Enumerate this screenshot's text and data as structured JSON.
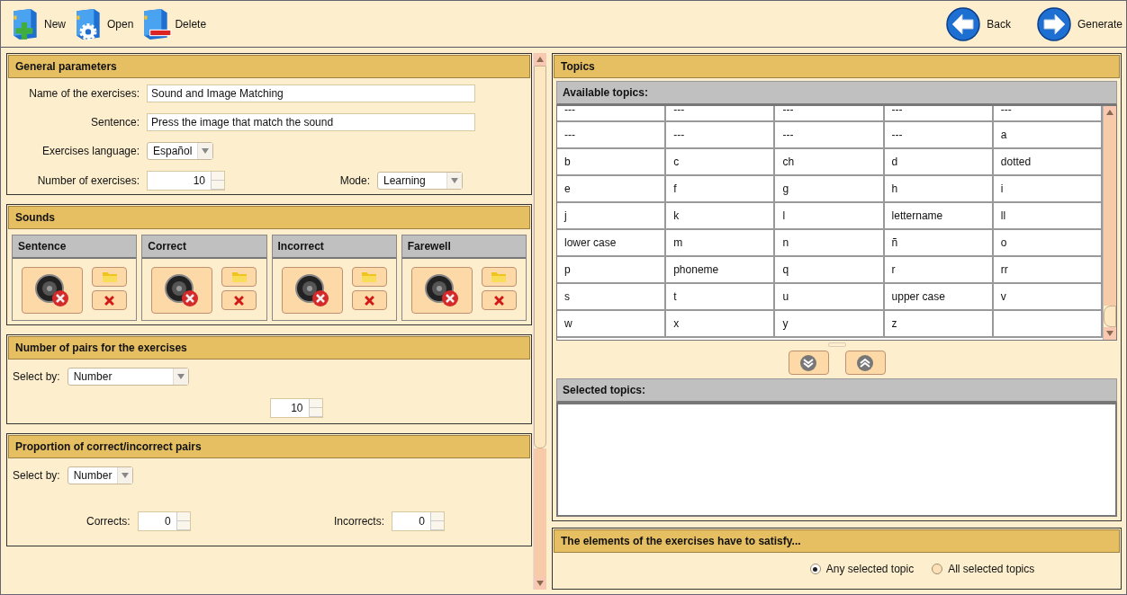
{
  "toolbar": {
    "left": [
      {
        "kind": "new",
        "label": "New"
      },
      {
        "kind": "open",
        "label": "Open"
      },
      {
        "kind": "delete",
        "label": "Delete"
      }
    ],
    "right": [
      {
        "kind": "back",
        "label": "Back"
      },
      {
        "kind": "generate",
        "label": "Generate"
      }
    ]
  },
  "general": {
    "title": "General parameters",
    "name_label": "Name of the exercises:",
    "name_value": "Sound and Image Matching",
    "sentence_label": "Sentence:",
    "sentence_value": "Press the image that match the sound",
    "language_label": "Exercises language:",
    "language_value": "Español",
    "number_label": "Number of exercises:",
    "number_value": "10",
    "mode_label": "Mode:",
    "mode_value": "Learning"
  },
  "sounds": {
    "title": "Sounds",
    "items": [
      {
        "title": "Sentence"
      },
      {
        "title": "Correct"
      },
      {
        "title": "Incorrect"
      },
      {
        "title": "Farewell"
      }
    ]
  },
  "pairs": {
    "title": "Number of pairs for the exercises",
    "select_label": "Select by:",
    "select_value": "Number",
    "number_value": "10"
  },
  "proportion": {
    "title": "Proportion of correct/incorrect pairs",
    "select_label": "Select by:",
    "select_value": "Number",
    "corrects_label": "Corrects:",
    "corrects_value": "0",
    "incorrects_label": "Incorrects:",
    "incorrects_value": "0"
  },
  "topics": {
    "title": "Topics",
    "available_label": "Available topics:",
    "rows": [
      [
        "---",
        "---",
        "---",
        "---",
        "---"
      ],
      [
        "---",
        "---",
        "---",
        "---",
        "a"
      ],
      [
        "b",
        "c",
        "ch",
        "d",
        "dotted"
      ],
      [
        "e",
        "f",
        "g",
        "h",
        "i"
      ],
      [
        "j",
        "k",
        "l",
        "lettername",
        "ll"
      ],
      [
        "lower case",
        "m",
        "n",
        "ñ",
        "o"
      ],
      [
        "p",
        "phoneme",
        "q",
        "r",
        "rr"
      ],
      [
        "s",
        "t",
        "u",
        "upper case",
        "v"
      ],
      [
        "w",
        "x",
        "y",
        "z",
        ""
      ]
    ],
    "selected_label": "Selected topics:"
  },
  "satisfy": {
    "title": "The elements of the exercises have to satisfy...",
    "options": [
      {
        "label": "Any selected topic",
        "selected": true
      },
      {
        "label": "All selected topics",
        "selected": false
      }
    ]
  }
}
